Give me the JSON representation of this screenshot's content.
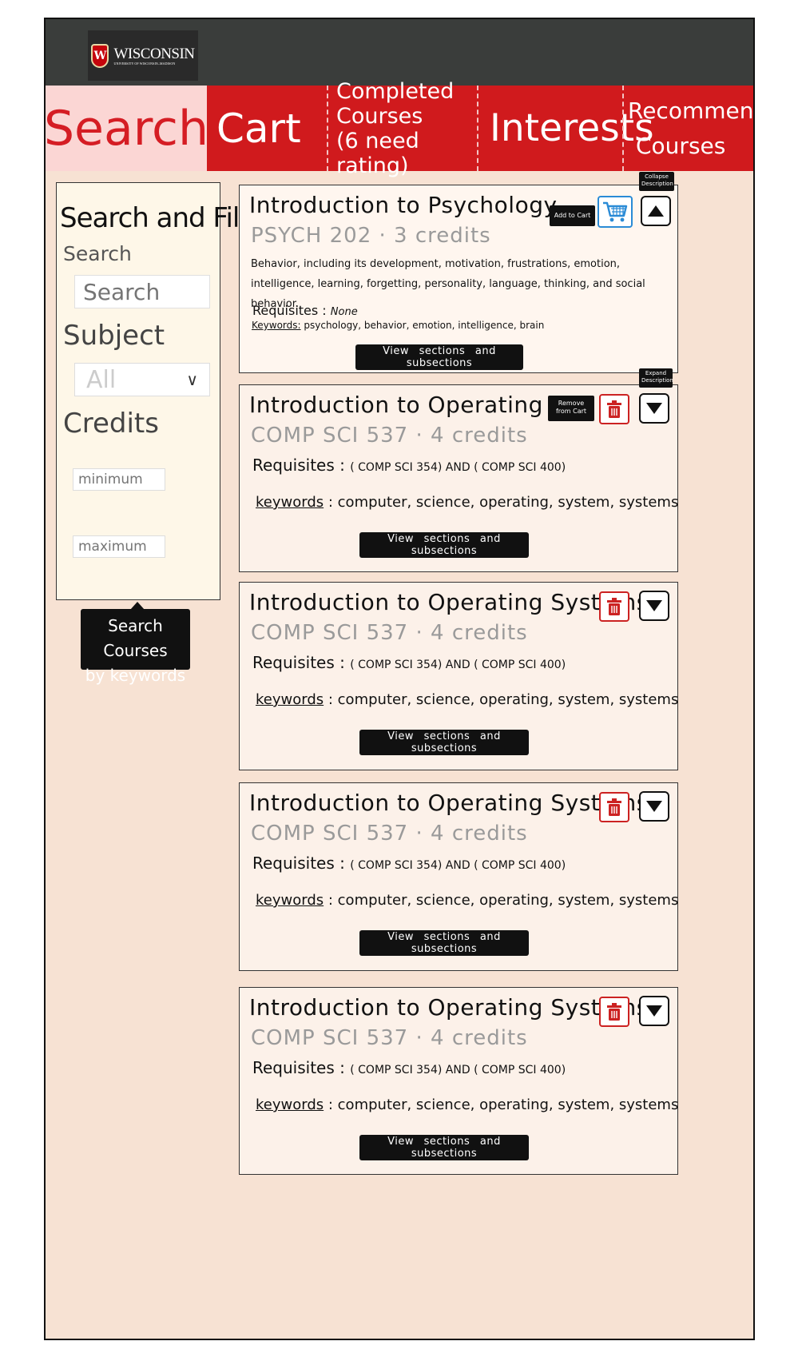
{
  "header": {
    "logo_name": "WISCONSIN",
    "logo_subtitle": "UNIVERSITY OF WISCONSIN–MADISON",
    "logo_mark": "W"
  },
  "tabs": [
    {
      "label": "Search",
      "active": true
    },
    {
      "label": "Cart"
    },
    {
      "label_lines": [
        "Completed",
        "Courses",
        "(6 need rating)"
      ]
    },
    {
      "label": "Interests"
    },
    {
      "label_lines": [
        "Recommended",
        "Courses"
      ]
    }
  ],
  "sidebar": {
    "title": "Search and Filter",
    "search_label": "Search",
    "search_placeholder": "Search",
    "subject_label": "Subject",
    "subject_value": "All",
    "credits_label": "Credits",
    "min_placeholder": "minimum",
    "max_placeholder": "maximum"
  },
  "tooltips": {
    "search_courses": [
      "Search Courses",
      "by keywords"
    ],
    "add_to_cart": "Add to Cart",
    "collapse": "Collapse Description",
    "expand": "Expand Description",
    "remove": "Remove from Cart"
  },
  "courses": [
    {
      "title": "Introduction to Psychology",
      "code": "PSYCH 202 · 3 credits",
      "description": "Behavior, including its development, motivation, frustrations, emotion, intelligence, learning, forgetting, personality, language, thinking, and social behavior.",
      "req_label": "Requisites :",
      "requisites": "None",
      "kw_label": "Keywords:",
      "keywords": "psychology, behavior, emotion, intelligence, brain",
      "button": "View sections and subsections"
    },
    {
      "title": "Introduction to Operating Sys",
      "code": "COMP SCI 537 · 4 credits",
      "req_label": "Requisites :",
      "requisites": "( COMP SCI 354) AND ( COMP SCI 400)",
      "kw_label": "keywords",
      "keywords": ": computer, science, operating, system, systems",
      "button": "View sections and subsections"
    },
    {
      "title": "Introduction to Operating Systems",
      "code": "COMP SCI 537 · 4 credits",
      "req_label": "Requisites :",
      "requisites": "( COMP SCI 354) AND ( COMP SCI 400)",
      "kw_label": "keywords",
      "keywords": ": computer, science, operating, system, systems",
      "button": "View sections and subsections"
    },
    {
      "title": "Introduction to Operating Systems",
      "code": "COMP SCI 537 · 4 credits",
      "req_label": "Requisites :",
      "requisites": "( COMP SCI 354) AND ( COMP SCI 400)",
      "kw_label": "keywords",
      "keywords": ": computer, science, operating, system, systems",
      "button": "View sections and subsections"
    },
    {
      "title": "Introduction to Operating Systems",
      "code": "COMP SCI 537 · 4 credits",
      "req_label": "Requisites :",
      "requisites": "( COMP SCI 354) AND ( COMP SCI 400)",
      "kw_label": "keywords",
      "keywords": ": computer, science, operating, system, systems",
      "button": "View sections and subsections"
    }
  ],
  "colors": {
    "topbar": "#3a3d3b",
    "tab_red": "#d01a1d",
    "tab_active_bg": "#fbd6d4",
    "tab_active_text": "#d51d24",
    "page_bg": "#f7e2d3",
    "cart_blue": "#2a8bd6",
    "trash_red": "#cc2222"
  },
  "icons": [
    "cart-icon",
    "trash-icon",
    "collapse-arrow-icon",
    "expand-arrow-icon",
    "chevron-down-icon",
    "uw-crest-icon"
  ]
}
